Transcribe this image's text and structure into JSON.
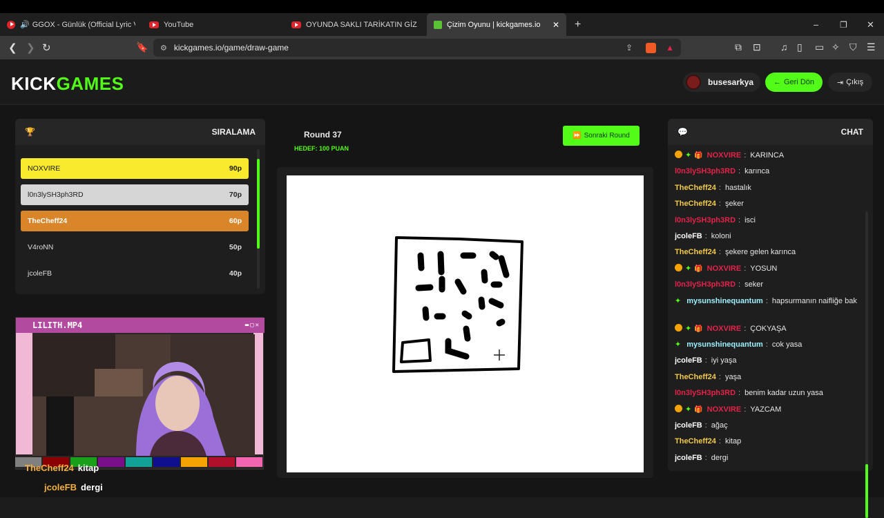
{
  "browser": {
    "tabs": [
      {
        "title": "GGOX - Günlük (Official Lyric Vid"
      },
      {
        "title": "YouTube"
      },
      {
        "title": "OYUNDA SAKLI TARİKATIN GİZLİ SIRI"
      },
      {
        "title": "Çizim Oyunu | kickgames.io",
        "active": true
      }
    ],
    "new_tab": "+",
    "window_controls": {
      "minimize": "–",
      "restore": "❐",
      "close": "✕"
    },
    "url": "kickgames.io/game/draw-game"
  },
  "header": {
    "logo_a": "KICK",
    "logo_b": "GAMES",
    "username": "busesarkya",
    "back_label": "Geri Dön",
    "logout_label": "Çıkış"
  },
  "leaderboard": {
    "title": "SIRALAMA",
    "rows": [
      {
        "name": "NOXVIRE",
        "score": "90p"
      },
      {
        "name": "l0n3lySH3ph3RD",
        "score": "70p"
      },
      {
        "name": "TheCheff24",
        "score": "60p"
      },
      {
        "name": "V4roNN",
        "score": "50p"
      },
      {
        "name": "jcoleFB",
        "score": "40p"
      }
    ]
  },
  "video": {
    "title": "LILITH.MP4",
    "overlay_messages": [
      {
        "user": "TheCheff24",
        "text": "kitap"
      },
      {
        "user": "jcoleFB",
        "text": "dergi"
      }
    ],
    "swatches": [
      "#808080",
      "#8b0000",
      "#1a9f1a",
      "#7a0f8a",
      "#12a197",
      "#10108f",
      "#f5a300",
      "#b0102c",
      "#f465b0"
    ]
  },
  "game": {
    "round_label": "Round 37",
    "target_label": "HEDEF: 100 PUAN",
    "next_round_label": "Sonraki Round"
  },
  "chat": {
    "title": "CHAT",
    "colors": {
      "red": "#e5234a",
      "yellow": "#f2c94c",
      "white": "#ffffff",
      "cyan": "#9ef0ff",
      "accent": "#53fc18"
    },
    "messages": [
      {
        "user": "NOXVIRE",
        "color": "red",
        "badges": true,
        "text": "KARINCA"
      },
      {
        "user": "l0n3lySH3ph3RD",
        "color": "red",
        "text": "karınca"
      },
      {
        "user": "TheCheff24",
        "color": "yellow",
        "text": "hastalık"
      },
      {
        "user": "TheCheff24",
        "color": "yellow",
        "text": "şeker"
      },
      {
        "user": "l0n3lySH3ph3RD",
        "color": "red",
        "text": "isci"
      },
      {
        "user": "jcoleFB",
        "color": "white",
        "text": "koloni"
      },
      {
        "user": "TheCheff24",
        "color": "yellow",
        "text": "şekere gelen karınca"
      },
      {
        "user": "NOXVIRE",
        "color": "red",
        "badges": true,
        "text": "YOSUN"
      },
      {
        "user": "l0n3lySH3ph3RD",
        "color": "red",
        "text": "seker"
      },
      {
        "user": "mysunshinequantum",
        "color": "cyan",
        "sparkle": true,
        "text": "hapsurmanın naifliğe bak"
      },
      {
        "user": "NOXVIRE",
        "color": "red",
        "badges": true,
        "text": "ÇOKYAŞA"
      },
      {
        "user": "mysunshinequantum",
        "color": "cyan",
        "sparkle": true,
        "text": "cok yasa"
      },
      {
        "user": "jcoleFB",
        "color": "white",
        "text": "iyi yaşa"
      },
      {
        "user": "TheCheff24",
        "color": "yellow",
        "text": "yaşa"
      },
      {
        "user": "l0n3lySH3ph3RD",
        "color": "red",
        "text": "benim kadar uzun yasa"
      },
      {
        "user": "NOXVIRE",
        "color": "red",
        "badges": true,
        "text": "YAZCAM"
      },
      {
        "user": "jcoleFB",
        "color": "white",
        "text": "ağaç"
      },
      {
        "user": "TheCheff24",
        "color": "yellow",
        "text": "kitap"
      },
      {
        "user": "jcoleFB",
        "color": "white",
        "text": "dergi"
      }
    ]
  }
}
